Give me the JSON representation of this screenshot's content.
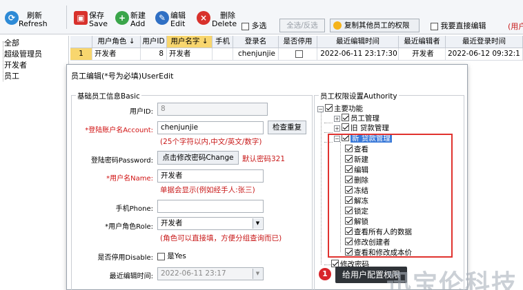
{
  "toolbar": {
    "refresh_label": "刷新",
    "refresh_sub": "Refresh",
    "save_label": "保存",
    "save_sub": "Save",
    "add_label": "新建",
    "add_sub": "Add",
    "edit_label": "编辑",
    "edit_sub": "Edit",
    "delete_label": "删除",
    "delete_sub": "Delete",
    "multiselect_label": "多选",
    "selectall_label": "全选/反选",
    "copy_perm_label": "复制其他员工的权限",
    "direct_edit_label": "我要直接编辑",
    "usage_label": "(用户"
  },
  "left_tree": {
    "items": [
      "全部",
      "超级管理员",
      "开发者",
      "员工"
    ]
  },
  "grid": {
    "headers": [
      "用户角色 ↓",
      "用户ID",
      "用户名字 ↓",
      "手机",
      "登录名",
      "是否停用",
      "最近编辑时间",
      "最近编辑者",
      "最近登录时间"
    ],
    "row": {
      "index": "1",
      "role": "开发者",
      "id": "8",
      "name": "开发者",
      "phone": "",
      "login": "chenjunjie",
      "disabled": false,
      "edit_time": "2022-06-11 23:17:30",
      "editor": "开发者",
      "login_time": "2022-06-12 09:32:1"
    }
  },
  "dialog": {
    "title": "员工编辑(*号为必填)UserEdit",
    "basic_group": "基础员工信息Basic",
    "fields": {
      "userid_label": "用户ID:",
      "userid_value": "8",
      "account_label": "*登陆账户名Account:",
      "account_value": "chenjunjie",
      "account_check_button": "检查重复",
      "account_hint": "(25个字符以内,中文/英文/数字)",
      "password_label": "登陆密码Password:",
      "password_button": "点击修改密码Change",
      "password_hint": "默认密码321",
      "name_label": "*用户名Name:",
      "name_value": "开发者",
      "name_hint": "单据会显示(例如经手人:张三)",
      "phone_label": "手机Phone:",
      "phone_value": "",
      "role_label": "*用户角色Role:",
      "role_value": "开发者",
      "role_hint": "(角色可以直接填，方便分组查询而已)",
      "disable_label": "是否停用Disable:",
      "disable_checkbox": "是Yes",
      "edittime_label": "最近编辑时间:",
      "edittime_value": "2022-06-11 23:17"
    },
    "authority_group": "员工权限设置Authority",
    "tree": {
      "root": "主要功能",
      "employee_mgmt": "员工管理",
      "old_loan_mgmt": "旧 贷款管理",
      "new_loan_mgmt": "新 贷款管理",
      "children": [
        "查看",
        "新建",
        "编辑",
        "删除",
        "冻结",
        "解冻",
        "锁定",
        "解锁",
        "查看所有人的数据",
        "修改创建者",
        "查看和修改成本价"
      ],
      "change_password": "修改密码"
    }
  },
  "tooltip": {
    "badge": "1",
    "text": "给用户配置权限"
  },
  "watermark": "迅宝伦科技",
  "colors": {
    "required_red": "#d01010",
    "highlight_box": "#e0322e",
    "selected_row": "#fde9a8",
    "selected_node": "#3a79d8"
  }
}
